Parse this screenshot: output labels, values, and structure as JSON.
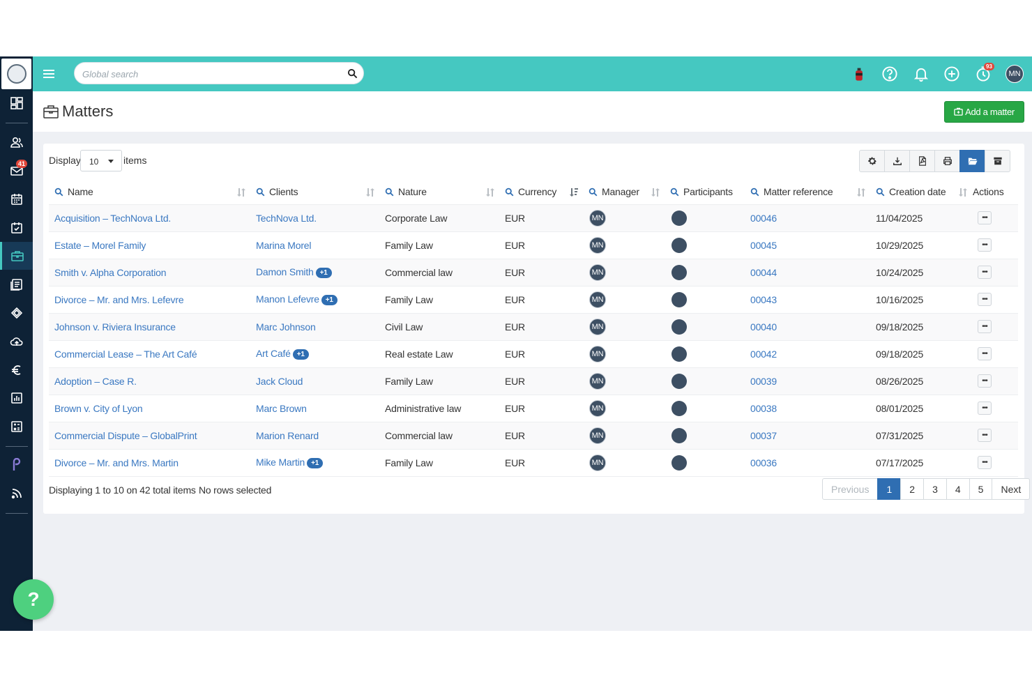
{
  "topbar": {
    "search_placeholder": "Global search",
    "timer_badge": "93",
    "user_initials": "MN"
  },
  "sidebar": {
    "mail_badge": "41",
    "items": [
      "dashboard-icon",
      "contacts-icon",
      "mail-icon",
      "calendar-icon",
      "tasks-icon",
      "matters-icon",
      "documents-icon",
      "deals-icon",
      "cloud-upload-icon",
      "billing-euro-icon",
      "reports-icon",
      "calculator-icon",
      "p-app-icon",
      "rss-icon"
    ],
    "active_item": "matters-icon"
  },
  "header": {
    "title": "Matters",
    "add_button": "Add a matter",
    "accent_color": "#45c8c1",
    "button_color": "#28a745"
  },
  "table_controls": {
    "display_label": "Display",
    "page_size": "10",
    "items_label": "items"
  },
  "columns": [
    "Name",
    "Clients",
    "Nature",
    "Currency",
    "Manager",
    "Participants",
    "Matter reference",
    "Creation date",
    "Actions"
  ],
  "rows": [
    {
      "name": "Acquisition – TechNova Ltd.",
      "client": "TechNova Ltd.",
      "extra": "",
      "nature": "Corporate Law",
      "currency": "EUR",
      "manager": "MN",
      "reference": "00046",
      "date": "11/04/2025"
    },
    {
      "name": "Estate – Morel Family",
      "client": "Marina Morel",
      "extra": "",
      "nature": "Family Law",
      "currency": "EUR",
      "manager": "MN",
      "reference": "00045",
      "date": "10/29/2025"
    },
    {
      "name": "Smith v. Alpha Corporation",
      "client": "Damon Smith",
      "extra": "+1",
      "nature": "Commercial law",
      "currency": "EUR",
      "manager": "MN",
      "reference": "00044",
      "date": "10/24/2025"
    },
    {
      "name": "Divorce – Mr. and Mrs. Lefevre",
      "client": "Manon Lefevre",
      "extra": "+1",
      "nature": "Family Law",
      "currency": "EUR",
      "manager": "MN",
      "reference": "00043",
      "date": "10/16/2025"
    },
    {
      "name": "Johnson v. Riviera Insurance",
      "client": "Marc Johnson",
      "extra": "",
      "nature": "Civil Law",
      "currency": "EUR",
      "manager": "MN",
      "reference": "00040",
      "date": "09/18/2025"
    },
    {
      "name": "Commercial Lease – The Art Café",
      "client": "Art Café",
      "extra": "+1",
      "nature": "Real estate Law",
      "currency": "EUR",
      "manager": "MN",
      "reference": "00042",
      "date": "09/18/2025"
    },
    {
      "name": "Adoption – Case R.",
      "client": "Jack Cloud",
      "extra": "",
      "nature": "Family Law",
      "currency": "EUR",
      "manager": "MN",
      "reference": "00039",
      "date": "08/26/2025"
    },
    {
      "name": "Brown v. City of Lyon",
      "client": "Marc Brown",
      "extra": "",
      "nature": "Administrative law",
      "currency": "EUR",
      "manager": "MN",
      "reference": "00038",
      "date": "08/01/2025"
    },
    {
      "name": "Commercial Dispute – GlobalPrint",
      "client": "Marion Renard",
      "extra": "",
      "nature": "Commercial law",
      "currency": "EUR",
      "manager": "MN",
      "reference": "00037",
      "date": "07/31/2025"
    },
    {
      "name": "Divorce – Mr. and Mrs. Martin",
      "client": "Mike Martin",
      "extra": "+1",
      "nature": "Family Law",
      "currency": "EUR",
      "manager": "MN",
      "reference": "00036",
      "date": "07/17/2025"
    }
  ],
  "footer": {
    "info": "Displaying 1 to 10 on 42 total items",
    "selection": "No rows selected",
    "pagination": [
      "Previous",
      "1",
      "2",
      "3",
      "4",
      "5",
      "Next"
    ],
    "current_page": "1"
  },
  "help_button": "?"
}
